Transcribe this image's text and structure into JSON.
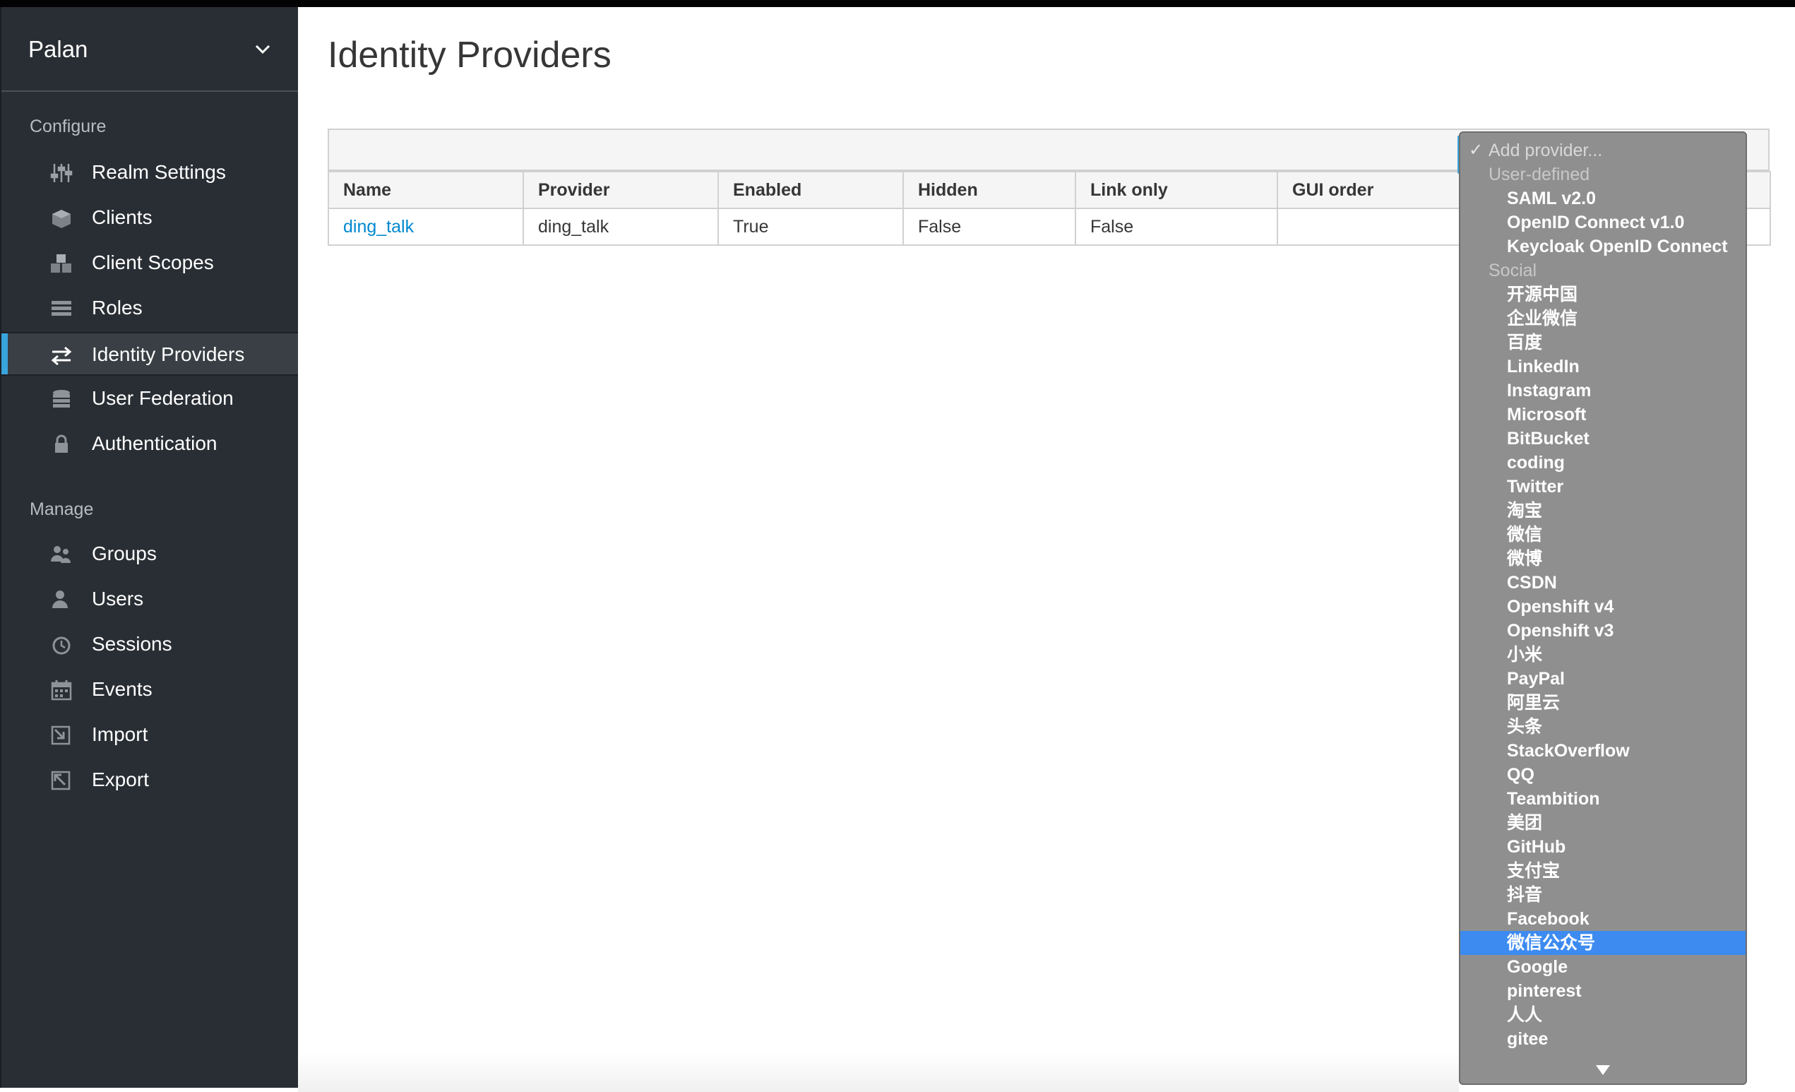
{
  "realm": {
    "name": "Palan"
  },
  "sidebar": {
    "configure_title": "Configure",
    "manage_title": "Manage",
    "configure_items": [
      {
        "label": "Realm Settings",
        "icon": "sliders-icon"
      },
      {
        "label": "Clients",
        "icon": "cube-icon"
      },
      {
        "label": "Client Scopes",
        "icon": "cubes-icon"
      },
      {
        "label": "Roles",
        "icon": "list-icon"
      },
      {
        "label": "Identity Providers",
        "icon": "exchange-icon",
        "active": true
      },
      {
        "label": "User Federation",
        "icon": "database-icon"
      },
      {
        "label": "Authentication",
        "icon": "lock-icon"
      }
    ],
    "manage_items": [
      {
        "label": "Groups",
        "icon": "users-icon"
      },
      {
        "label": "Users",
        "icon": "user-icon"
      },
      {
        "label": "Sessions",
        "icon": "clock-icon"
      },
      {
        "label": "Events",
        "icon": "calendar-icon"
      },
      {
        "label": "Import",
        "icon": "import-icon"
      },
      {
        "label": "Export",
        "icon": "export-icon"
      }
    ]
  },
  "page": {
    "title": "Identity Providers"
  },
  "table": {
    "headers": [
      "Name",
      "Provider",
      "Enabled",
      "Hidden",
      "Link only",
      "GUI order"
    ],
    "rows": [
      {
        "name": "ding_talk",
        "provider": "ding_talk",
        "enabled": "True",
        "hidden": "False",
        "link_only": "False",
        "gui_order": ""
      }
    ]
  },
  "add_provider": {
    "placeholder": "Add provider...",
    "groups": [
      {
        "label": "User-defined",
        "options": [
          "SAML v2.0",
          "OpenID Connect v1.0",
          "Keycloak OpenID Connect"
        ]
      },
      {
        "label": "Social",
        "options": [
          "开源中国",
          "企业微信",
          "百度",
          "LinkedIn",
          "Instagram",
          "Microsoft",
          "BitBucket",
          "coding",
          "Twitter",
          "淘宝",
          "微信",
          "微博",
          "CSDN",
          "Openshift v4",
          "Openshift v3",
          "小米",
          "PayPal",
          "阿里云",
          "头条",
          "StackOverflow",
          "QQ",
          "Teambition",
          "美团",
          "GitHub",
          "支付宝",
          "抖音",
          "Facebook",
          "微信公众号",
          "Google",
          "pinterest",
          "人人",
          "gitee"
        ]
      }
    ],
    "highlighted": "微信公众号",
    "accent_color": "#3d8bf0"
  }
}
